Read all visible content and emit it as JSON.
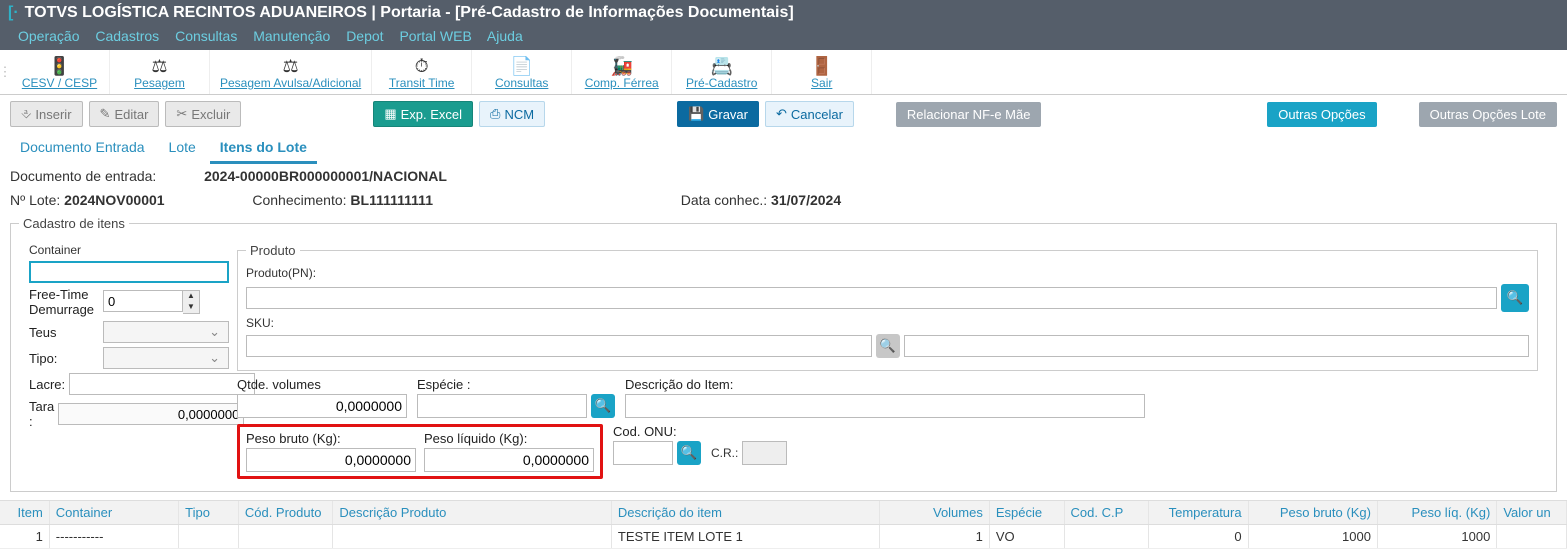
{
  "title": "TOTVS LOGÍSTICA RECINTOS ADUANEIROS | Portaria - [Pré-Cadastro de Informações Documentais]",
  "menu": [
    "Operação",
    "Cadastros",
    "Consultas",
    "Manutenção",
    "Depot",
    "Portal WEB",
    "Ajuda"
  ],
  "ribbon": [
    {
      "icon": "🚦",
      "label": "CESV / CESP"
    },
    {
      "icon": "⚖",
      "label": "Pesagem"
    },
    {
      "icon": "⚖",
      "label": "Pesagem Avulsa/Adicional"
    },
    {
      "icon": "⏱",
      "label": "Transit Time"
    },
    {
      "icon": "📄",
      "label": "Consultas"
    },
    {
      "icon": "🚂",
      "label": "Comp. Férrea"
    },
    {
      "icon": "📇",
      "label": "Pré-Cadastro"
    },
    {
      "icon": "🚪",
      "label": "Sair"
    }
  ],
  "toolbar": {
    "insert": "Inserir",
    "edit": "Editar",
    "delete": "Excluir",
    "expexcel": "Exp. Excel",
    "ncm": "NCM",
    "save": "Gravar",
    "cancel": "Cancelar",
    "relnfe": "Relacionar NF-e Mãe",
    "outras": "Outras Opções",
    "outraslote": "Outras Opções Lote"
  },
  "tabs": [
    "Documento Entrada",
    "Lote",
    "Itens do Lote"
  ],
  "active_tab": 2,
  "info": {
    "doc_label": "Documento de entrada:",
    "doc_value": "2024-00000BR000000001/NACIONAL",
    "lote_label": "Nº Lote:",
    "lote_value": "2024NOV00001",
    "conhec_label": "Conhecimento:",
    "conhec_value": "BL111111111",
    "dataconhec_label": "Data conhec.:",
    "dataconhec_value": "31/07/2024"
  },
  "groups": {
    "cadastro": "Cadastro de itens",
    "produto": "Produto"
  },
  "leftform": {
    "container_label": "Container",
    "container_value": "",
    "freetime_label": "Free-Time Demurrage",
    "freetime_value": "0",
    "teus_label": "Teus",
    "tipo_label": "Tipo:",
    "lacre_label": "Lacre:",
    "tara_label": "Tara :",
    "tara_value": "0,0000000"
  },
  "prodform": {
    "produto_label": "Produto(PN):",
    "sku_label": "SKU:",
    "qtde_label": "Qtde. volumes",
    "qtde_value": "0,0000000",
    "especie_label": "Espécie :",
    "descitem_label": "Descrição do Item:",
    "pesobruto_label": "Peso bruto (Kg):",
    "pesobruto_value": "0,0000000",
    "pesoliq_label": "Peso líquido (Kg):",
    "pesoliq_value": "0,0000000",
    "codonu_label": "Cod. ONU:",
    "cr_label": "C.R.:"
  },
  "grid": {
    "headers": {
      "item": "Item",
      "container": "Container",
      "tipo": "Tipo",
      "codp": "Cód. Produto",
      "descp": "Descrição Produto",
      "desci": "Descrição do item",
      "vol": "Volumes",
      "esp": "Espécie",
      "ccp": "Cod. C.P",
      "temp": "Temperatura",
      "pb": "Peso bruto (Kg)",
      "pl": "Peso líq. (Kg)",
      "val": "Valor un"
    },
    "rows": [
      {
        "item": "1",
        "container": "-----------",
        "tipo": "",
        "codp": "",
        "descp": "",
        "desci": "TESTE ITEM LOTE 1",
        "vol": "1",
        "esp": "VO",
        "ccp": "",
        "temp": "0",
        "pb": "1000",
        "pl": "1000",
        "val": ""
      }
    ]
  }
}
